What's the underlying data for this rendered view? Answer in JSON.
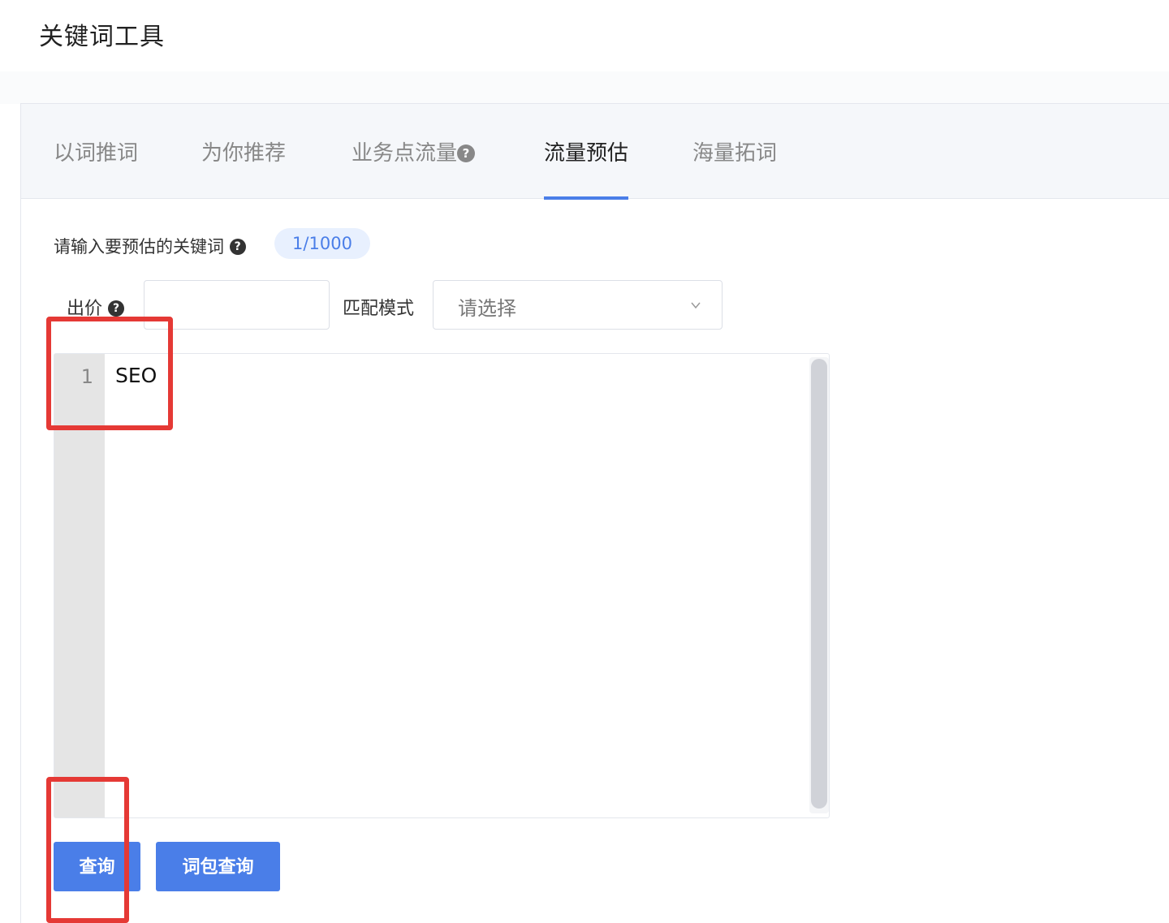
{
  "header": {
    "title": "关键词工具"
  },
  "tabs": [
    {
      "label": "以词推词"
    },
    {
      "label": "为你推荐"
    },
    {
      "label": "业务点流量"
    },
    {
      "label": "流量预估"
    },
    {
      "label": "海量拓词"
    }
  ],
  "active_tab": "流量预估",
  "form": {
    "keyword_label": "请输入要预估的关键词",
    "count": "1/1000",
    "bid_label": "出价",
    "bid_value": "",
    "match_label": "匹配模式",
    "match_placeholder": "请选择"
  },
  "editor": {
    "lines": [
      {
        "no": "1",
        "text": "SEO"
      }
    ]
  },
  "buttons": {
    "query": "查询",
    "pack_query": "词包查询"
  },
  "colors": {
    "accent": "#4a7ee8",
    "highlight": "#e53935",
    "pill_bg": "#e8f0fe"
  },
  "icons": {
    "help": "?"
  }
}
